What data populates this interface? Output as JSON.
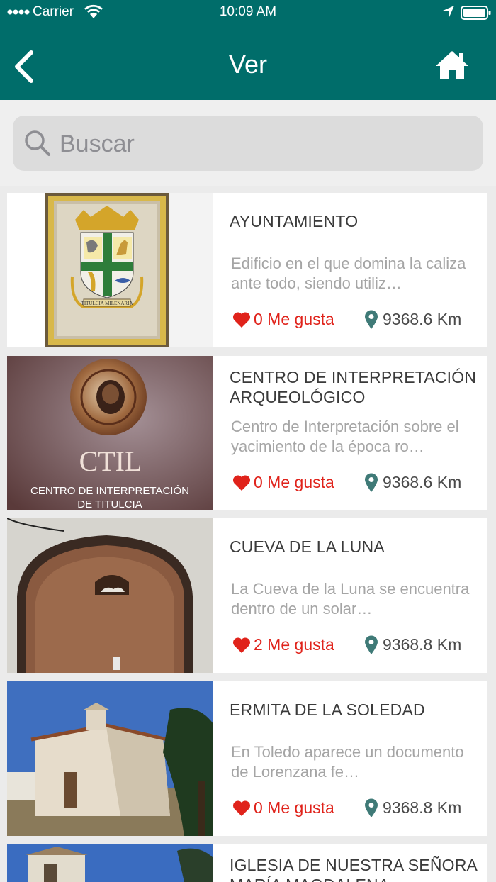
{
  "status_bar": {
    "carrier": "Carrier",
    "time": "10:09 AM"
  },
  "header": {
    "title": "Ver"
  },
  "search": {
    "placeholder": "Buscar"
  },
  "colors": {
    "header_bg": "#006d6a",
    "like_red": "#e0231b",
    "pin_teal": "#3f7a77"
  },
  "items": [
    {
      "title": "AYUNTAMIENTO",
      "description": "Edificio en el que domina la caliza ante todo, siendo utiliz…",
      "likes": "0 Me gusta",
      "distance": "9368.6 Km",
      "image": "coat-of-arms",
      "image_caption": "TITULCIA MILENARIA"
    },
    {
      "title": "CENTRO DE INTERPRETACIÓN ARQUEOLÓGICO",
      "description": "Centro de Interpretación sobre el yacimiento de la época ro…",
      "likes": "0 Me gusta",
      "distance": "9368.6 Km",
      "image": "ctil-sign",
      "image_logo": "CTIL",
      "image_line1": "CENTRO DE INTERPRETACIÓN",
      "image_line2": "DE TITULCIA"
    },
    {
      "title": "CUEVA DE LA LUNA",
      "description": "La Cueva de la Luna se encuentra dentro de un solar…",
      "likes": "2 Me gusta",
      "distance": "9368.8 Km",
      "image": "cave-arch"
    },
    {
      "title": "ERMITA DE LA SOLEDAD",
      "description": "En Toledo aparece un documento de Lorenzana fe…",
      "likes": "0 Me gusta",
      "distance": "9368.8 Km",
      "image": "white-chapel"
    },
    {
      "title": "IGLESIA DE NUESTRA SEÑORA MARÍA MAGDALENA",
      "image": "church-tower"
    }
  ]
}
